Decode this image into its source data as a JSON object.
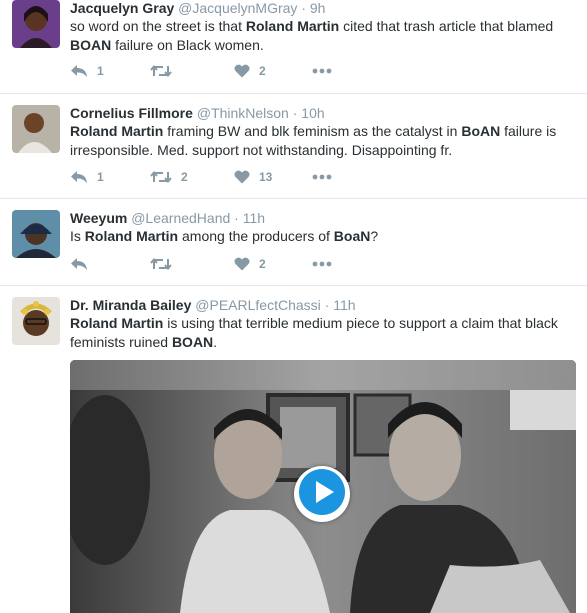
{
  "tweets": [
    {
      "name": "Jacquelyn Gray",
      "handle": "@JacquelynMGray",
      "time": "9h",
      "text": [
        {
          "t": "so word on the street is that ",
          "b": false
        },
        {
          "t": "Roland Martin",
          "b": true
        },
        {
          "t": " cited that trash article that blamed ",
          "b": false
        },
        {
          "t": "BOAN",
          "b": true
        },
        {
          "t": " failure on Black women.",
          "b": false
        }
      ],
      "replies": "1",
      "retweets": "",
      "likes": "2"
    },
    {
      "name": "Cornelius Fillmore",
      "handle": "@ThinkNelson",
      "time": "10h",
      "text": [
        {
          "t": "Roland Martin",
          "b": true
        },
        {
          "t": " framing BW and blk feminism as the catalyst in ",
          "b": false
        },
        {
          "t": "BoAN",
          "b": true
        },
        {
          "t": " failure is irresponsible. Med. support not withstanding. Disappointing fr.",
          "b": false
        }
      ],
      "replies": "1",
      "retweets": "2",
      "likes": "13"
    },
    {
      "name": "Weeyum",
      "handle": "@LearnedHand",
      "time": "11h",
      "text": [
        {
          "t": "Is ",
          "b": false
        },
        {
          "t": "Roland Martin",
          "b": true
        },
        {
          "t": " among the producers of ",
          "b": false
        },
        {
          "t": "BoaN",
          "b": true
        },
        {
          "t": "?",
          "b": false
        }
      ],
      "replies": "",
      "retweets": "",
      "likes": "2"
    },
    {
      "name": "Dr. Miranda Bailey",
      "handle": "@PEARLfectChassi",
      "time": "11h",
      "text": [
        {
          "t": "Roland Martin",
          "b": true
        },
        {
          "t": " is using that terrible medium piece to support a claim that black feminists ruined ",
          "b": false
        },
        {
          "t": "BOAN",
          "b": true
        },
        {
          "t": ".",
          "b": false
        }
      ]
    }
  ],
  "separator": "·",
  "colors": {
    "name": "#292f33",
    "meta": "#8899a6",
    "divider": "#e1e8ed",
    "play": "#1b95e0"
  },
  "icons": {
    "reply": "reply-icon",
    "retweet": "retweet-icon",
    "like": "heart-icon",
    "more": "more-icon",
    "play": "play-icon"
  }
}
